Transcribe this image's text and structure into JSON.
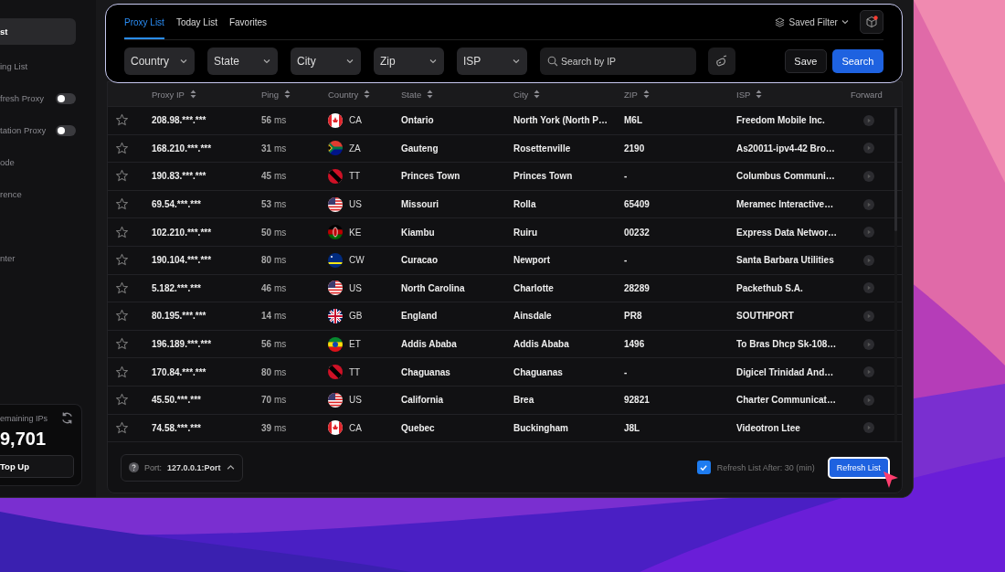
{
  "sidebar": {
    "items": [
      {
        "label": "st",
        "selected": true
      },
      {
        "label": "ing List",
        "selected": false
      },
      {
        "label": "fresh Proxy",
        "selected": false,
        "kind": "toggle",
        "on": false
      },
      {
        "label": "tation Proxy",
        "selected": false,
        "kind": "toggle",
        "on": false
      },
      {
        "label": "ode",
        "selected": false
      },
      {
        "label": "rence",
        "selected": false
      },
      {
        "label": "nter",
        "selected": false
      }
    ],
    "remaining": {
      "label": "emaining IPs",
      "value": "9,701",
      "button": "Top Up"
    }
  },
  "tabs": [
    {
      "label": "Proxy List",
      "selected": true
    },
    {
      "label": "Today List",
      "selected": false
    },
    {
      "label": "Favorites",
      "selected": false
    }
  ],
  "saved_filter": "Saved Filter",
  "filters": [
    "Country",
    "State",
    "City",
    "Zip",
    "ISP"
  ],
  "search": {
    "placeholder": "Search by IP"
  },
  "buttons": {
    "save": "Save",
    "search": "Search"
  },
  "table": {
    "columns": [
      "Proxy IP",
      "Ping",
      "Country",
      "State",
      "City",
      "ZIP",
      "ISP",
      "Forward"
    ],
    "rows": [
      {
        "ip": "208.98.***.***",
        "ping": "**56** ms",
        "kind": "ca",
        "country": "CA",
        "state": "Ontario",
        "city": "North York (North P…",
        "zip": "M6L",
        "isp": "Freedom Mobile Inc."
      },
      {
        "ip": "168.210.***.***",
        "ping": "**31** ms",
        "kind": "za",
        "country": "ZA",
        "state": "Gauteng",
        "city": "Rosettenville",
        "zip": "2190",
        "isp": "As20011-ipv4-42 Bro…"
      },
      {
        "ip": "190.83.***.***",
        "ping": "**45** ms",
        "kind": "tt",
        "country": "TT",
        "state": "Princes Town",
        "city": "Princes Town",
        "zip": "-",
        "isp": "Columbus Communi…"
      },
      {
        "ip": "69.54.***.***",
        "ping": "**53** ms",
        "kind": "us",
        "country": "US",
        "state": "Missouri",
        "city": "Rolla",
        "zip": "65409",
        "isp": "Meramec Interactive…"
      },
      {
        "ip": "102.210.***.***",
        "ping": "**50** ms",
        "kind": "ke",
        "country": "KE",
        "state": "Kiambu",
        "city": "Ruiru",
        "zip": "00232",
        "isp": "Express Data Networ…"
      },
      {
        "ip": "190.104.***.***",
        "ping": "**80** ms",
        "kind": "cw",
        "country": "CW",
        "state": "Curacao",
        "city": "Newport",
        "zip": "-",
        "isp": "Santa Barbara Utilities"
      },
      {
        "ip": "5.182.***.***",
        "ping": "**46** ms",
        "kind": "us",
        "country": "US",
        "state": "North Carolina",
        "city": "Charlotte",
        "zip": "28289",
        "isp": "Packethub S.A."
      },
      {
        "ip": "80.195.***.***",
        "ping": "**14** ms",
        "kind": "gb",
        "country": "GB",
        "state": "England",
        "city": "Ainsdale",
        "zip": "PR8",
        "isp": "SOUTHPORT"
      },
      {
        "ip": "196.189.***.***",
        "ping": "**56** ms",
        "kind": "et",
        "country": "ET",
        "state": "Addis Ababa",
        "city": "Addis Ababa",
        "zip": "1496",
        "isp": "To  Bras Dhcp Sk-108…"
      },
      {
        "ip": "170.84.***.***",
        "ping": "**80** ms",
        "kind": "tt",
        "country": "TT",
        "state": "Chaguanas",
        "city": "Chaguanas",
        "zip": "-",
        "isp": "Digicel Trinidad And…"
      },
      {
        "ip": "45.50.***.***",
        "ping": "**70** ms",
        "kind": "us",
        "country": "US",
        "state": "California",
        "city": "Brea",
        "zip": "92821",
        "isp": "Charter Communicat…"
      },
      {
        "ip": "74.58.***.***",
        "ping": "**39** ms",
        "kind": "ca",
        "country": "CA",
        "state": "Quebec",
        "city": "Buckingham",
        "zip": "J8L",
        "isp": "Videotron Ltee"
      }
    ]
  },
  "footer": {
    "port_label": "Port:",
    "port_value": "127.0.0.1:Port",
    "refresh_checked": true,
    "refresh_label": "Refresh List After: 30 (min)",
    "refresh_button": "Refresh List"
  }
}
